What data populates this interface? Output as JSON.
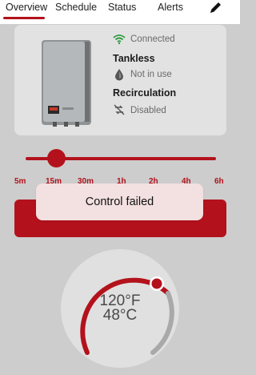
{
  "tabs": [
    {
      "label": "Overview",
      "active": true
    },
    {
      "label": "Schedule",
      "active": false
    },
    {
      "label": "Status",
      "active": false
    },
    {
      "label": "Alerts",
      "active": false
    }
  ],
  "edit_icon": "pencil-icon",
  "device": {
    "connection_status": "Connected",
    "tankless_title": "Tankless",
    "tankless_status": "Not in use",
    "recirculation_title": "Recirculation",
    "recirculation_status": "Disabled"
  },
  "duration_slider": {
    "labels": [
      "5m",
      "15m",
      "30m",
      "1h",
      "2h",
      "4h",
      "6h"
    ],
    "selected": "15m"
  },
  "toast": {
    "message": "Control failed"
  },
  "temperature": {
    "fahrenheit": "120°F",
    "celsius": "48°C"
  },
  "colors": {
    "accent": "#b3121c",
    "connected": "#2e9b3e",
    "background": "#cdcdcd",
    "card": "#e2e2e2"
  }
}
